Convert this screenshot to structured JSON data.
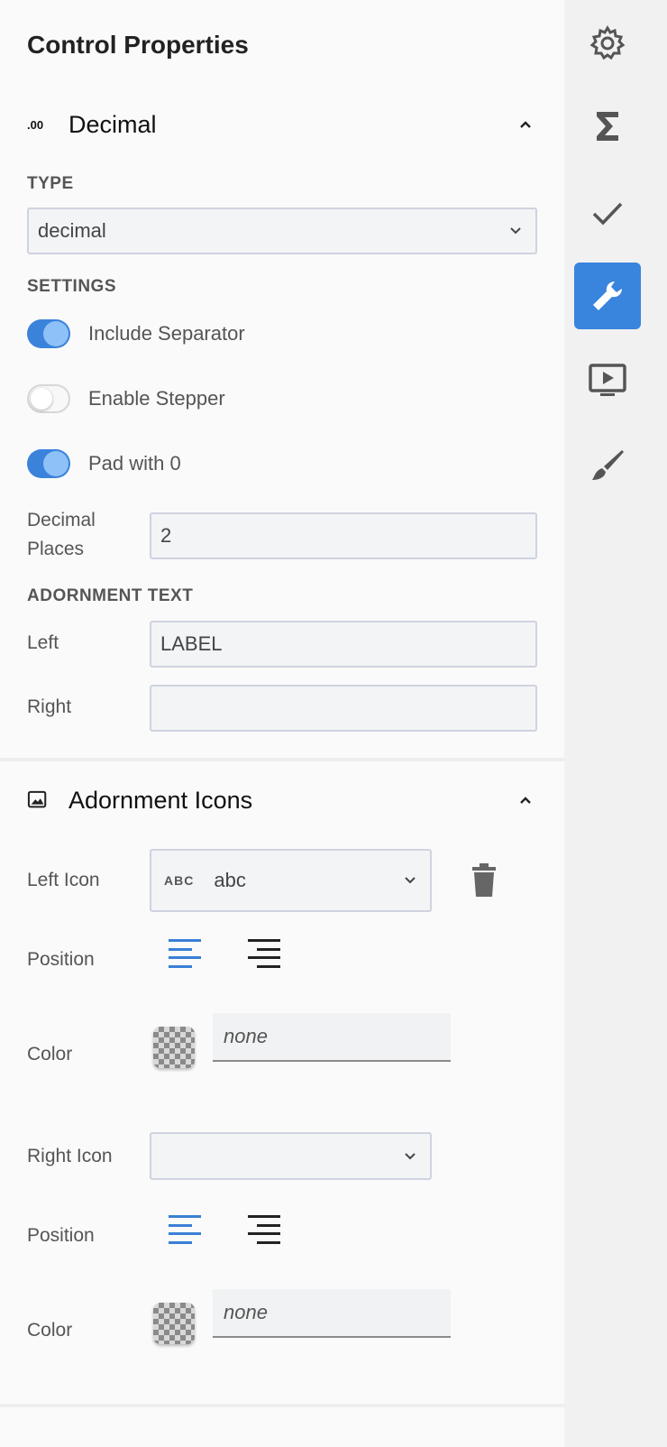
{
  "header": {
    "title": "Control Properties"
  },
  "decimal_section": {
    "title": "Decimal",
    "icon": "decimal-icon",
    "type_label": "TYPE",
    "type_value": "decimal",
    "settings_label": "SETTINGS",
    "toggles": [
      {
        "label": "Include Separator",
        "on": true
      },
      {
        "label": "Enable Stepper",
        "on": false
      },
      {
        "label": "Pad with 0",
        "on": true
      }
    ],
    "decimal_places_label_line1": "Decimal",
    "decimal_places_label_line2": "Places",
    "decimal_places_value": "2",
    "adornment_text_label": "ADORNMENT TEXT",
    "left_label": "Left",
    "left_value": "LABEL",
    "right_label": "Right",
    "right_value": ""
  },
  "icons_section": {
    "title": "Adornment Icons",
    "icon": "image-icon",
    "left_icon_label": "Left Icon",
    "left_icon_glyph": "ABC",
    "left_icon_value": "abc",
    "position_label": "Position",
    "color_label": "Color",
    "left_color_placeholder": "none",
    "right_icon_label": "Right Icon",
    "right_icon_value": "",
    "right_color_placeholder": "none"
  },
  "rail": {
    "items": [
      "gear-icon",
      "sigma-icon",
      "check-icon",
      "wrench-icon",
      "preview-icon",
      "brush-icon"
    ],
    "active": "wrench-icon",
    "active_color": "#3984dd"
  }
}
